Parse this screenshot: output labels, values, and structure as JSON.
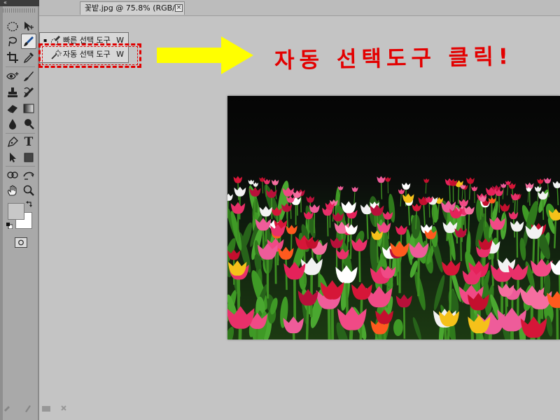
{
  "document": {
    "tab_title": "꽃밭.jpg @ 75.8% (RGB/8)",
    "close_glyph": "×"
  },
  "tools_panel": {
    "collapse_glyph": "«",
    "tools": [
      {
        "id": "marquee",
        "icon": "marquee-icon"
      },
      {
        "id": "move",
        "icon": "move-icon"
      },
      {
        "id": "lasso",
        "icon": "lasso-icon"
      },
      {
        "id": "quick-selection",
        "icon": "quick-selection-brush-icon",
        "active": true
      },
      {
        "id": "crop",
        "icon": "crop-icon"
      },
      {
        "id": "eyedropper",
        "icon": "eyedropper-icon"
      },
      {
        "id": "spot-healing",
        "icon": "spot-healing-icon"
      },
      {
        "id": "brush",
        "icon": "brush-icon"
      },
      {
        "id": "clone-stamp",
        "icon": "clone-stamp-icon"
      },
      {
        "id": "history-brush",
        "icon": "history-brush-icon"
      },
      {
        "id": "eraser",
        "icon": "eraser-icon"
      },
      {
        "id": "gradient",
        "icon": "gradient-icon"
      },
      {
        "id": "blur",
        "icon": "blur-icon"
      },
      {
        "id": "dodge",
        "icon": "dodge-icon"
      },
      {
        "id": "pen",
        "icon": "pen-icon"
      },
      {
        "id": "type",
        "icon": "type-icon",
        "glyph": "T"
      },
      {
        "id": "path-selection",
        "icon": "path-selection-icon"
      },
      {
        "id": "shape",
        "icon": "rectangle-shape-icon"
      },
      {
        "id": "3d-rotate",
        "icon": "3d-rotate-icon"
      },
      {
        "id": "3d-orbit",
        "icon": "3d-orbit-icon"
      },
      {
        "id": "hand",
        "icon": "hand-icon"
      },
      {
        "id": "zoom",
        "icon": "zoom-icon"
      }
    ],
    "foreground_color": "#c8c8c8",
    "background_color": "#ffffff"
  },
  "flyout": {
    "items": [
      {
        "label": "빠른 선택 도구",
        "shortcut": "W",
        "bullet": "▪",
        "icon": "quick-selection-icon",
        "current": true
      },
      {
        "label": "자동 선택 도구",
        "shortcut": "W",
        "bullet": "",
        "icon": "magic-wand-icon",
        "current": false
      }
    ]
  },
  "annotation": {
    "callout_text": "자동 선택도구 클릭!",
    "callout_color": "#e30000",
    "arrow_color": "#ffff00",
    "highlight_color": "#e00000"
  },
  "canvas": {
    "image_description_icon": "tulip-field-photo"
  }
}
